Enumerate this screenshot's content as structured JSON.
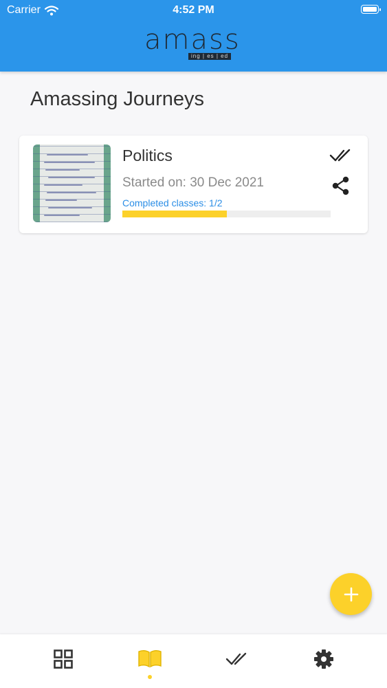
{
  "status_bar": {
    "carrier": "Carrier",
    "time": "4:52 PM"
  },
  "header": {
    "logo_text": "amass",
    "logo_tagline": "ing | es | ed"
  },
  "page": {
    "title": "Amassing Journeys"
  },
  "journeys": [
    {
      "title": "Politics",
      "started": "Started on: 30 Dec 2021",
      "progress_label": "Completed classes: 1/2",
      "progress_fraction": 0.5
    }
  ],
  "fab": {
    "icon": "plus-icon"
  },
  "bottom_nav": {
    "items": [
      {
        "icon": "grid-icon",
        "active": false
      },
      {
        "icon": "book-icon",
        "active": true
      },
      {
        "icon": "double-check-icon",
        "active": false
      },
      {
        "icon": "gear-icon",
        "active": false
      }
    ]
  },
  "colors": {
    "header": "#2b95ea",
    "accent": "#fcd12a",
    "link": "#2b8ee6",
    "background": "#f7f7f9"
  }
}
